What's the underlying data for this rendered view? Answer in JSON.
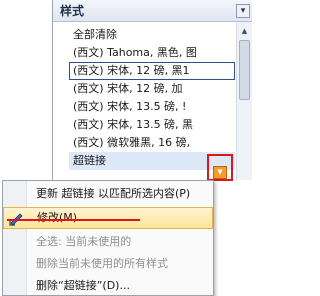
{
  "pane": {
    "title": "样式",
    "items": [
      {
        "label": "全部清除"
      },
      {
        "label": "(西文) Tahoma, 黑色, 图"
      },
      {
        "label": "(西文) 宋体, 12 磅, 黑1"
      },
      {
        "label": "(西文) 宋体, 12 磅, 加"
      },
      {
        "label": "(西文) 宋体, 13.5 磅, !"
      },
      {
        "label": "(西文) 宋体, 13.5 磅, 黑"
      },
      {
        "label": "(西文) 微软雅黑, 16 磅,"
      },
      {
        "label": "超链接"
      }
    ],
    "selected_index": 2,
    "current_index": 7,
    "dropdown_icon": "dropdown-arrow-icon"
  },
  "menu": {
    "items": [
      {
        "label": "更新 超链接 以匹配所选内容(P)",
        "enabled": true
      },
      {
        "label": "修改(M)...",
        "enabled": true,
        "icon": "edit-icon"
      },
      {
        "label": "全选: 当前未使用的",
        "enabled": false
      },
      {
        "label": "删除当前未使用的所有样式",
        "enabled": false
      },
      {
        "label": "删除“超链接”(D)...",
        "enabled": true
      }
    ]
  },
  "colors": {
    "highlight_annotation": "#e0151a",
    "dropdown_accent": "#f39c29",
    "menu_hover": "#ffe49b"
  }
}
